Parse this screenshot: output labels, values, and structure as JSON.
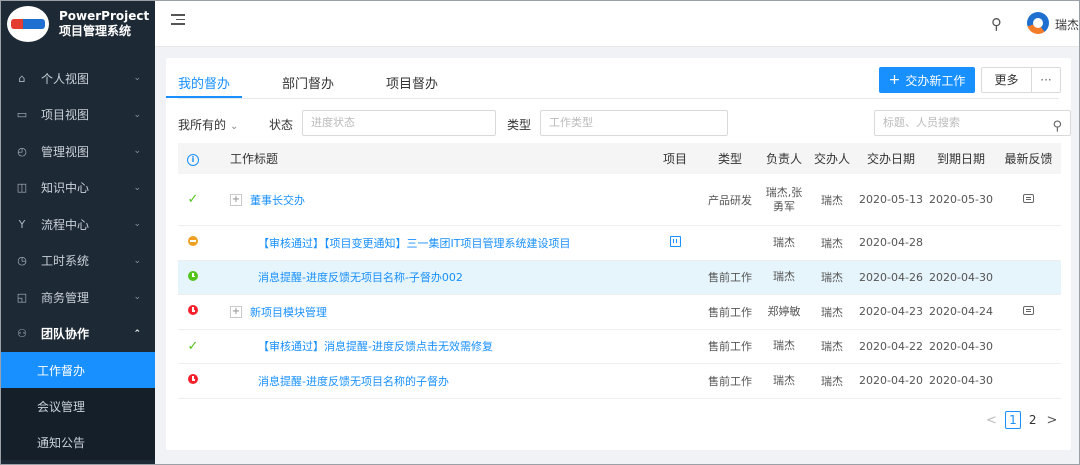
{
  "brand": {
    "line1": "PowerProject",
    "line2": "项目管理系统"
  },
  "topbar": {
    "user_name": "瑞杰"
  },
  "sidebar": {
    "items": [
      {
        "icon": "home-icon",
        "glyph": "⌂",
        "label": "个人视图",
        "arrow": "⌄"
      },
      {
        "icon": "monitor-icon",
        "glyph": "▭",
        "label": "项目视图",
        "arrow": "⌄"
      },
      {
        "icon": "dashboard-icon",
        "glyph": "◴",
        "label": "管理视图",
        "arrow": "⌄"
      },
      {
        "icon": "book-icon",
        "glyph": "◫",
        "label": "知识中心",
        "arrow": "⌄"
      },
      {
        "icon": "flow-icon",
        "glyph": "Y",
        "label": "流程中心",
        "arrow": "⌄"
      },
      {
        "icon": "clock-icon",
        "glyph": "◷",
        "label": "工时系统",
        "arrow": "⌄"
      },
      {
        "icon": "document-icon",
        "glyph": "◱",
        "label": "商务管理",
        "arrow": "⌄"
      },
      {
        "icon": "team-icon",
        "glyph": "⚇",
        "label": "团队协作",
        "arrow": "⌃"
      }
    ],
    "sub_items": [
      {
        "label": "工作督办"
      },
      {
        "label": "会议管理"
      },
      {
        "label": "通知公告"
      }
    ]
  },
  "tabs": [
    {
      "label": "我的督办"
    },
    {
      "label": "部门督办"
    },
    {
      "label": "项目督办"
    }
  ],
  "toolbar": {
    "new_button_label": "交办新工作",
    "more_label": "更多",
    "more_dots": "···"
  },
  "filters": {
    "owner_label": "我所有的",
    "status_label": "状态",
    "status_placeholder": "进度状态",
    "type_label": "类型",
    "type_placeholder": "工作类型",
    "search_placeholder": "标题、人员搜索"
  },
  "table": {
    "headers": {
      "title": "工作标题",
      "project": "项目",
      "type": "类型",
      "owner": "负责人",
      "assigner": "交办人",
      "assign_date": "交办日期",
      "due_date": "到期日期",
      "feedback": "最新反馈"
    },
    "rows": [
      {
        "status": "check",
        "expander": "+",
        "title": "董事长交办",
        "has_project": false,
        "type": "产品研发",
        "owner": "瑞杰,张勇军",
        "assigner": "瑞杰",
        "assign_date": "2020-05-13",
        "due_date": "2020-05-30",
        "feedback": true
      },
      {
        "status": "orange",
        "expander": "",
        "title": "【审核通过】【项目变更通知】三一集团IT项目管理系统建设项目",
        "has_project": true,
        "type": "",
        "owner": "瑞杰",
        "assigner": "瑞杰",
        "assign_date": "2020-04-28",
        "due_date": "",
        "feedback": false
      },
      {
        "status": "green",
        "expander": "",
        "title": "消息提醒-进度反馈无项目名称-子督办002",
        "has_project": false,
        "type": "售前工作",
        "owner": "瑞杰",
        "assigner": "瑞杰",
        "assign_date": "2020-04-26",
        "due_date": "2020-04-30",
        "feedback": false
      },
      {
        "status": "red",
        "expander": "+",
        "title": "新项目模块管理",
        "has_project": false,
        "type": "售前工作",
        "owner": "郑婷敏",
        "assigner": "瑞杰",
        "assign_date": "2020-04-23",
        "due_date": "2020-04-24",
        "feedback": true
      },
      {
        "status": "check",
        "expander": "",
        "title": "【审核通过】消息提醒-进度反馈点击无效需修复",
        "has_project": false,
        "type": "售前工作",
        "owner": "瑞杰",
        "assigner": "瑞杰",
        "assign_date": "2020-04-22",
        "due_date": "2020-04-30",
        "feedback": false
      },
      {
        "status": "red",
        "expander": "",
        "title": "消息提醒-进度反馈无项目名称的子督办",
        "has_project": false,
        "type": "售前工作",
        "owner": "瑞杰",
        "assigner": "瑞杰",
        "assign_date": "2020-04-20",
        "due_date": "2020-04-30",
        "feedback": false
      }
    ]
  },
  "pagination": {
    "prev": "<",
    "current": "1",
    "page2": "2",
    "next": ">"
  },
  "colors": {
    "primary": "#1890ff",
    "sidebar_bg": "#1d2935",
    "row_highlight": "#e6f4fb"
  }
}
